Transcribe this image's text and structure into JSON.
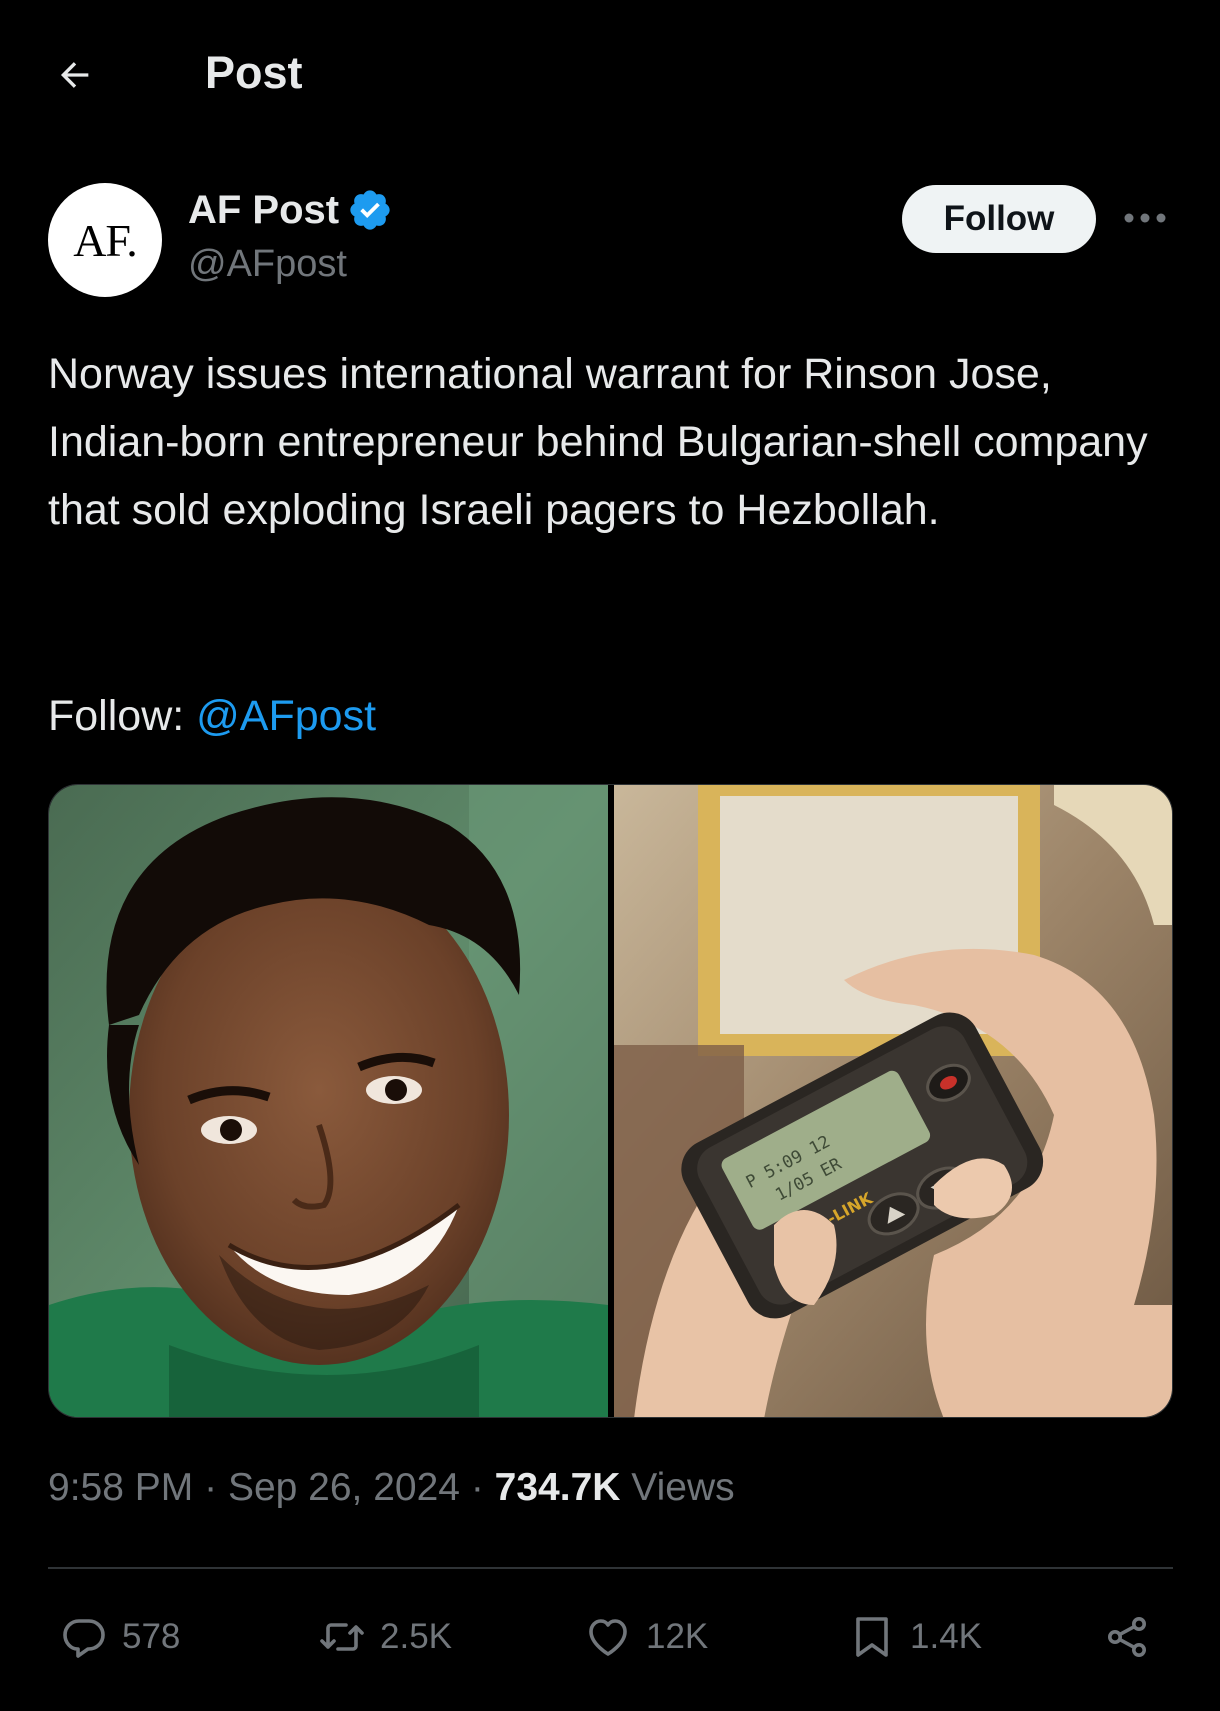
{
  "header": {
    "title": "Post",
    "back_icon": "arrow-left-icon"
  },
  "author": {
    "avatar_text": "AF.",
    "display_name": "AF Post",
    "handle": "@AFpost",
    "verified_icon": "verified-badge-icon",
    "verified_color": "#1d9bf0",
    "follow_label": "Follow",
    "more_icon": "more-horizontal-icon"
  },
  "post": {
    "text": "Norway issues international warrant for Rinson Jose, Indian-born entrepreneur behind Bulgarian-shell company that sold exploding Israeli pagers to Hezbollah.",
    "follow_prefix": "Follow: ",
    "mention": "@AFpost",
    "pager_brand": "ASTRA-LINK"
  },
  "meta": {
    "time": "9:58 PM",
    "separator": "·",
    "date": "Sep 26, 2024",
    "views_count": "734.7K",
    "views_label": "Views"
  },
  "actions": {
    "replies": {
      "icon": "reply-icon",
      "count": "578"
    },
    "reposts": {
      "icon": "repost-icon",
      "count": "2.5K"
    },
    "likes": {
      "icon": "heart-icon",
      "count": "12K"
    },
    "bookmarks": {
      "icon": "bookmark-icon",
      "count": "1.4K"
    },
    "share": {
      "icon": "share-icon"
    }
  },
  "colors": {
    "background": "#000000",
    "text_primary": "#e7e9ea",
    "text_secondary": "#71767b",
    "link": "#1d9bf0",
    "divider": "#2f3336"
  }
}
